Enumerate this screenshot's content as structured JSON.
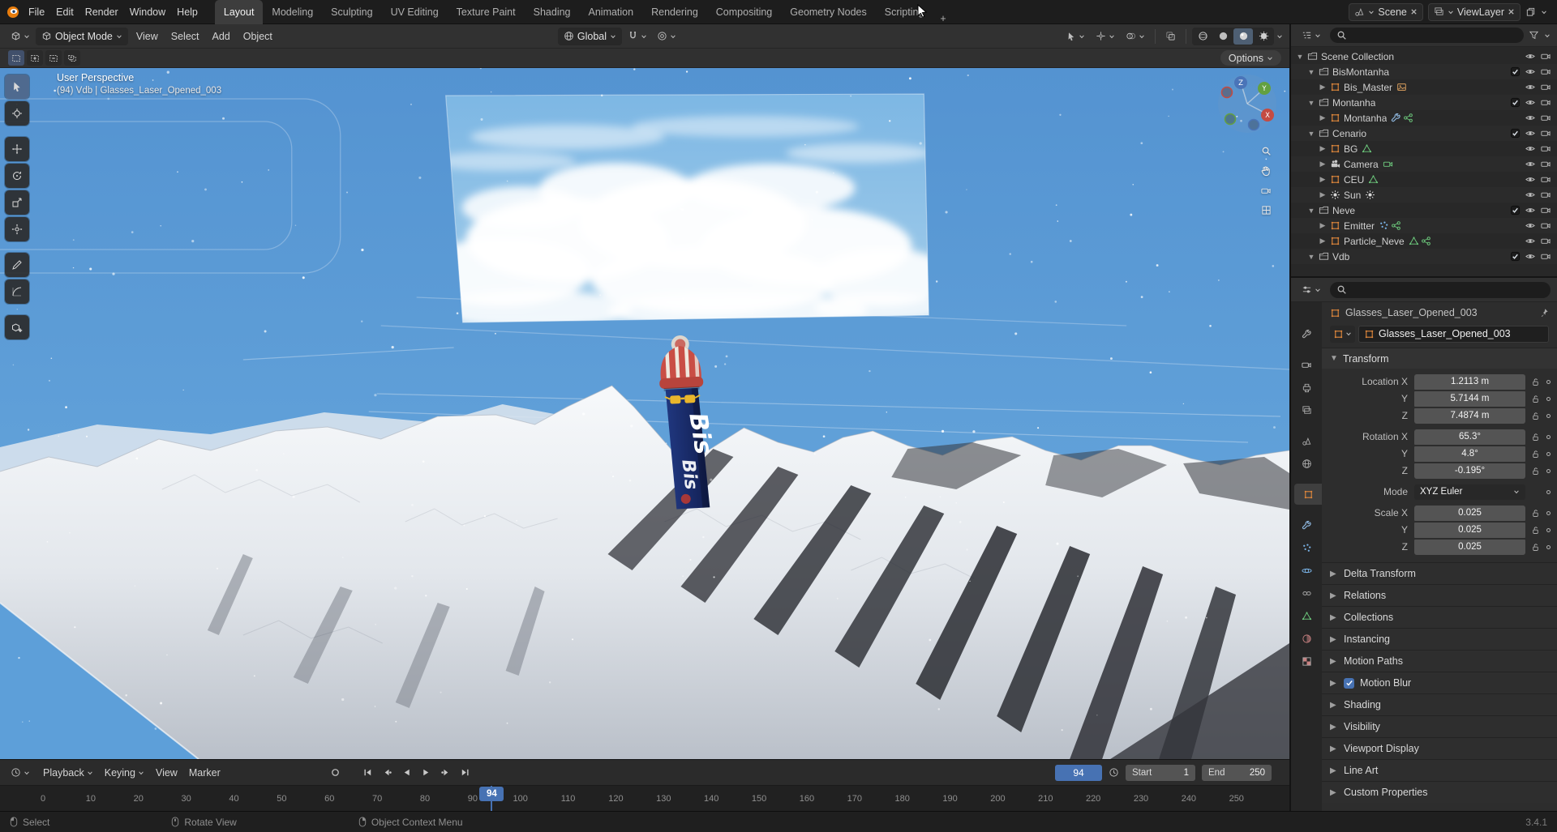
{
  "topbar": {
    "menus": [
      "File",
      "Edit",
      "Render",
      "Window",
      "Help"
    ],
    "workspaces": [
      "Layout",
      "Modeling",
      "Sculpting",
      "UV Editing",
      "Texture Paint",
      "Shading",
      "Animation",
      "Rendering",
      "Compositing",
      "Geometry Nodes",
      "Scripting"
    ],
    "active_workspace": "Layout",
    "add_workspace_label": "+",
    "scene": {
      "label": "Scene"
    },
    "view_layer": {
      "label": "ViewLayer"
    }
  },
  "viewport": {
    "header": {
      "mode": "Object Mode",
      "menus": [
        "View",
        "Select",
        "Add",
        "Object"
      ],
      "orientation": "Global",
      "shading_modes": [
        "wireframe",
        "solid",
        "material",
        "rendered"
      ],
      "active_shading": "material"
    },
    "tool_settings": {
      "options_label": "Options",
      "select_modes": [
        "new",
        "extend",
        "subtract",
        "intersect"
      ],
      "active_select_mode": "new"
    },
    "overlay": {
      "view_label": "User Perspective",
      "context_label": "(94) Vdb | Glasses_Laser_Opened_003"
    },
    "gizmo_axes": {
      "x": "X",
      "y": "Y",
      "z": "Z"
    },
    "scene_objects": {
      "package_text": "Bis"
    }
  },
  "toolbar": {
    "tools": [
      "select-box",
      "cursor",
      "move",
      "rotate",
      "scale",
      "transform",
      "annotate",
      "measure",
      "add-cube"
    ],
    "active_tool": "select-box"
  },
  "outliner": {
    "root_label": "Scene Collection",
    "items": [
      {
        "label": "BisMontanha",
        "level": 1,
        "icon": "collection",
        "disclosure": "expanded",
        "checkbox": true,
        "trailing": []
      },
      {
        "label": "Bis_Master",
        "level": 2,
        "icon": "object",
        "disclosure": "collapsed",
        "checkbox": false,
        "trailing": [
          "image"
        ]
      },
      {
        "label": "Montanha",
        "level": 1,
        "icon": "collection",
        "disclosure": "expanded",
        "checkbox": true,
        "trailing": []
      },
      {
        "label": "Montanha",
        "level": 2,
        "icon": "object",
        "disclosure": "collapsed",
        "checkbox": false,
        "trailing": [
          "modifier-wrench",
          "geometry-nodes"
        ]
      },
      {
        "label": "Cenario",
        "level": 1,
        "icon": "collection",
        "disclosure": "expanded",
        "checkbox": true,
        "trailing": []
      },
      {
        "label": "BG",
        "level": 2,
        "icon": "object",
        "disclosure": "collapsed",
        "checkbox": false,
        "trailing": [
          "mesh-data"
        ]
      },
      {
        "label": "Camera",
        "level": 2,
        "icon": "camera",
        "disclosure": "collapsed",
        "checkbox": false,
        "trailing": [
          "camera-data"
        ]
      },
      {
        "label": "CEU",
        "level": 2,
        "icon": "object",
        "disclosure": "collapsed",
        "checkbox": false,
        "trailing": [
          "mesh-data"
        ]
      },
      {
        "label": "Sun",
        "level": 2,
        "icon": "light",
        "disclosure": "collapsed",
        "checkbox": false,
        "trailing": [
          "light-data"
        ]
      },
      {
        "label": "Neve",
        "level": 1,
        "icon": "collection",
        "disclosure": "expanded",
        "checkbox": true,
        "trailing": []
      },
      {
        "label": "Emitter",
        "level": 2,
        "icon": "object",
        "disclosure": "collapsed",
        "checkbox": false,
        "trailing": [
          "particles",
          "geometry-nodes"
        ]
      },
      {
        "label": "Particle_Neve",
        "level": 2,
        "icon": "object",
        "disclosure": "collapsed",
        "checkbox": false,
        "trailing": [
          "mesh-data",
          "geometry-nodes"
        ]
      },
      {
        "label": "Vdb",
        "level": 1,
        "icon": "collection",
        "disclosure": "expanded",
        "checkbox": true,
        "trailing": []
      }
    ]
  },
  "properties": {
    "breadcrumb": "Glasses_Laser_Opened_003",
    "object_name": "Glasses_Laser_Opened_003",
    "tabs": [
      {
        "id": "tool"
      },
      {
        "id": "render"
      },
      {
        "id": "output"
      },
      {
        "id": "view-layer"
      },
      {
        "id": "scene"
      },
      {
        "id": "world"
      },
      {
        "id": "object",
        "active": true
      },
      {
        "id": "modifiers"
      },
      {
        "id": "particles"
      },
      {
        "id": "physics"
      },
      {
        "id": "constraints"
      },
      {
        "id": "data"
      },
      {
        "id": "material"
      },
      {
        "id": "texture"
      }
    ],
    "transform": {
      "title": "Transform",
      "groups": [
        {
          "rows": [
            {
              "label": "Location X",
              "value": "1.2113 m"
            },
            {
              "label": "Y",
              "value": "5.7144 m"
            },
            {
              "label": "Z",
              "value": "7.4874 m"
            }
          ]
        },
        {
          "rows": [
            {
              "label": "Rotation X",
              "value": "65.3°"
            },
            {
              "label": "Y",
              "value": "4.8°"
            },
            {
              "label": "Z",
              "value": "-0.195°"
            }
          ]
        },
        {
          "dropdown": true,
          "rows": [
            {
              "label": "Mode",
              "value": "XYZ Euler"
            }
          ]
        },
        {
          "rows": [
            {
              "label": "Scale X",
              "value": "0.025"
            },
            {
              "label": "Y",
              "value": "0.025"
            },
            {
              "label": "Z",
              "value": "0.025"
            }
          ]
        }
      ]
    },
    "sections": [
      {
        "label": "Delta Transform"
      },
      {
        "label": "Relations"
      },
      {
        "label": "Collections"
      },
      {
        "label": "Instancing"
      },
      {
        "label": "Motion Paths"
      },
      {
        "label": "Motion Blur",
        "checked": true
      },
      {
        "label": "Shading"
      },
      {
        "label": "Visibility"
      },
      {
        "label": "Viewport Display"
      },
      {
        "label": "Line Art"
      },
      {
        "label": "Custom Properties"
      }
    ]
  },
  "timeline": {
    "menus": [
      "Playback",
      "Keying",
      "View",
      "Marker"
    ],
    "transport": [
      "jump-start",
      "key-prev",
      "play-reverse",
      "play",
      "key-next",
      "jump-end"
    ],
    "current_frame": "94",
    "start_label": "Start",
    "start_value": "1",
    "end_label": "End",
    "end_value": "250",
    "ruler_labels": [
      0,
      10,
      20,
      30,
      40,
      50,
      60,
      70,
      80,
      90,
      100,
      110,
      120,
      130,
      140,
      150,
      160,
      170,
      180,
      190,
      200,
      210,
      220,
      230,
      240,
      250
    ],
    "playhead_frame": 94
  },
  "statusbar": {
    "hints": [
      {
        "mouse": "left",
        "label": "Select"
      },
      {
        "mouse": "middle",
        "label": "Rotate View"
      },
      {
        "mouse": "right",
        "label": "Object Context Menu"
      }
    ],
    "version": "3.4.1"
  }
}
